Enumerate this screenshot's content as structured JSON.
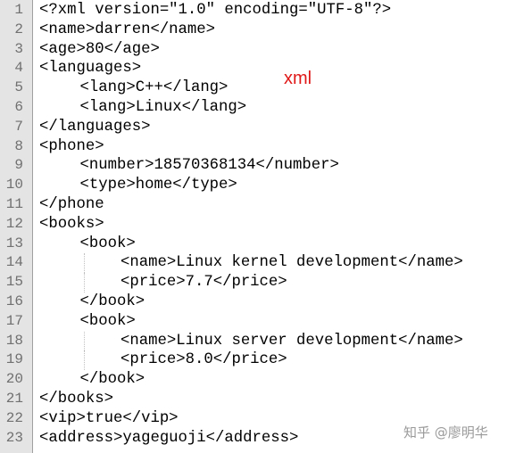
{
  "editor": {
    "lines": [
      {
        "n": "1",
        "indent": 0,
        "text": "<?xml version=\"1.0\" encoding=\"UTF-8\"?>"
      },
      {
        "n": "2",
        "indent": 0,
        "text": "<name>darren</name>"
      },
      {
        "n": "3",
        "indent": 0,
        "text": "<age>80</age>"
      },
      {
        "n": "4",
        "indent": 0,
        "text": "<languages>"
      },
      {
        "n": "5",
        "indent": 1,
        "text": "<lang>C++</lang>"
      },
      {
        "n": "6",
        "indent": 1,
        "text": "<lang>Linux</lang>"
      },
      {
        "n": "7",
        "indent": 0,
        "text": "</languages>"
      },
      {
        "n": "8",
        "indent": 0,
        "text": "<phone>"
      },
      {
        "n": "9",
        "indent": 1,
        "text": "<number>18570368134</number>"
      },
      {
        "n": "10",
        "indent": 1,
        "text": "<type>home</type>"
      },
      {
        "n": "11",
        "indent": 0,
        "text": "</phone"
      },
      {
        "n": "12",
        "indent": 0,
        "text": "<books>"
      },
      {
        "n": "13",
        "indent": 1,
        "text": "<book>"
      },
      {
        "n": "14",
        "indent": 2,
        "text": "<name>Linux kernel development</name>"
      },
      {
        "n": "15",
        "indent": 2,
        "text": "<price>7.7</price>"
      },
      {
        "n": "16",
        "indent": 1,
        "text": "</book>"
      },
      {
        "n": "17",
        "indent": 1,
        "text": "<book>"
      },
      {
        "n": "18",
        "indent": 2,
        "text": "<name>Linux server development</name>"
      },
      {
        "n": "19",
        "indent": 2,
        "text": "<price>8.0</price>"
      },
      {
        "n": "20",
        "indent": 1,
        "text": "</book>"
      },
      {
        "n": "21",
        "indent": 0,
        "text": "</books>"
      },
      {
        "n": "22",
        "indent": 0,
        "text": "<vip>true</vip>"
      },
      {
        "n": "23",
        "indent": 0,
        "text": "<address>yageguoji</address>"
      }
    ]
  },
  "annotation": {
    "label": "xml",
    "color": "#e01818"
  },
  "watermark": {
    "text": "知乎 @廖明华"
  },
  "colors": {
    "gutter": "#e4e4e4",
    "line_number": "#707070",
    "text": "#000000"
  }
}
